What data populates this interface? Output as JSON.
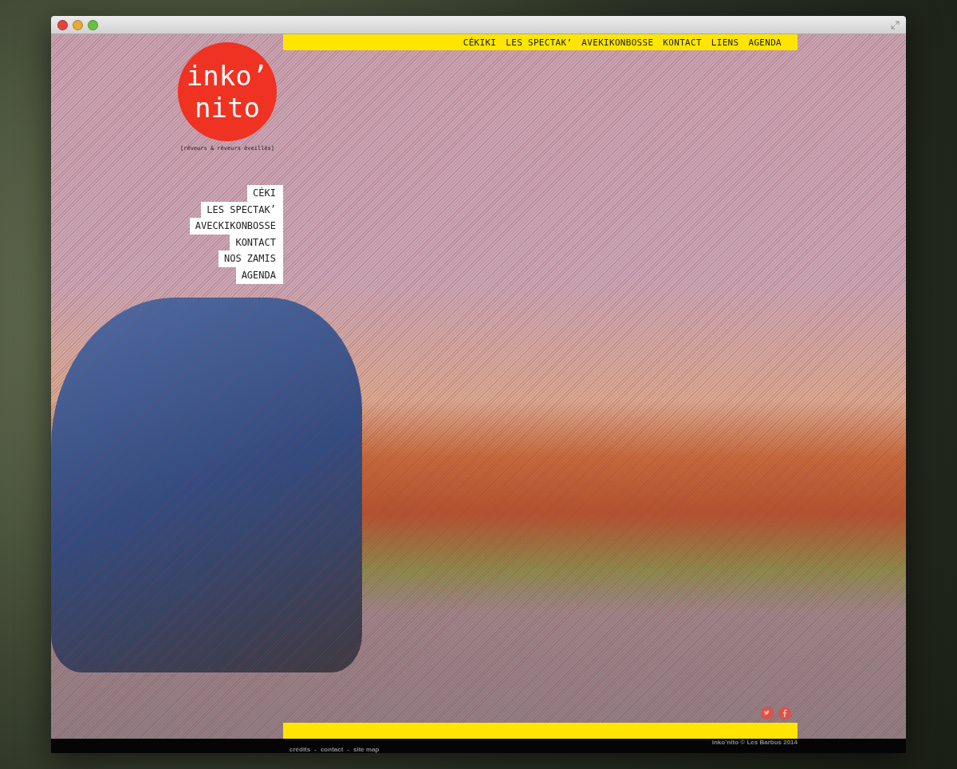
{
  "top_nav": [
    {
      "label": "CÉKIKI"
    },
    {
      "label": "LES SPECTAK’"
    },
    {
      "label": "AVEKIKONBOSSE"
    },
    {
      "label": "KONTACT"
    },
    {
      "label": "LIENS"
    },
    {
      "label": "AGENDA"
    }
  ],
  "logo": {
    "line_1": "inko’",
    "line_2": "nito"
  },
  "tagline": "[rêveurs & rêveurs éveillés]",
  "side_nav": [
    {
      "label": "CÉKI"
    },
    {
      "label": "LES SPECTAK’"
    },
    {
      "label": "AVECKIKONBOSSE"
    },
    {
      "label": "KONTACT"
    },
    {
      "label": "NOS ZAMIS"
    },
    {
      "label": "AGENDA"
    }
  ],
  "footer": {
    "links": [
      "crédits",
      "contact",
      "site map"
    ],
    "separator": "-",
    "copyright": "inko’nito © Les Barbus 2014"
  }
}
